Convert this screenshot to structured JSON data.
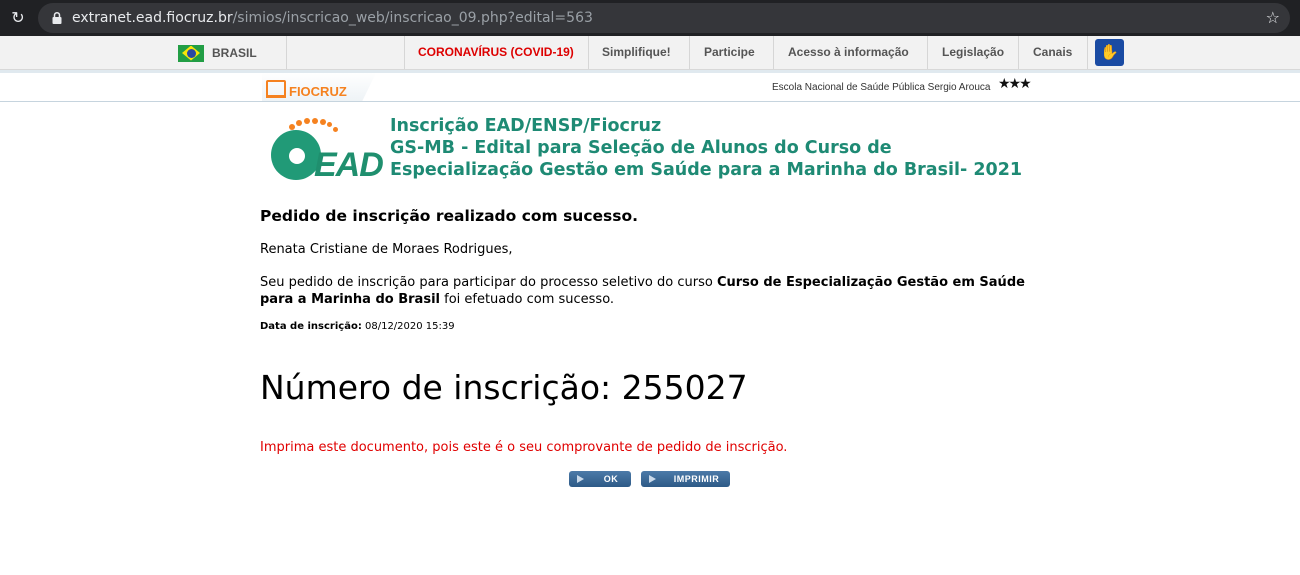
{
  "browser": {
    "url_host": "extranet.ead.fiocruz.br",
    "url_path": "/simios/inscricao_web/inscricao_09.php?edital=563",
    "reload_icon": "reload-icon",
    "lock_icon": "lock-icon",
    "star_icon": "star-icon"
  },
  "govbar": {
    "brasil": "BRASIL",
    "links": [
      "CORONAVÍRUS (COVID-19)",
      "Simplifique!",
      "Participe",
      "Acesso à informação",
      "Legislação",
      "Canais"
    ],
    "highlight_color": "#dd0000",
    "accessibility_icon": "accessibility-icon"
  },
  "fiocruz": {
    "logo_text": "FIOCRUZ",
    "ensp_text": "Escola Nacional de Saúde Pública Sergio Arouca",
    "brand_color": "#f58220"
  },
  "header": {
    "logo_text": "EAD",
    "title_line1": "Inscrição EAD/ENSP/Fiocruz",
    "title_line2": "GS-MB - Edital para Seleção de Alunos do Curso de",
    "title_line3": "Especialização Gestão em Saúde para a Marinha do Brasil- 2021",
    "title_color": "#1e8a74"
  },
  "content": {
    "success": "Pedido de inscrição realizado com sucesso.",
    "name": "Renata Cristiane de Moraes Rodrigues,",
    "msg_pre": "Seu pedido de inscrição para participar do processo seletivo do curso ",
    "msg_course": "Curso de Especialização Gestão em Saúde para a Marinha do Brasil",
    "msg_post": " foi efetuado com sucesso.",
    "date_label": "Data de inscrição:",
    "date_value": " 08/12/2020 15:39",
    "number": "Número de inscrição: 255027",
    "print_notice": "Imprima este documento, pois este é o seu comprovante de pedido de inscrição.",
    "notice_color": "#e00000"
  },
  "buttons": {
    "ok": "OK",
    "print": "IMPRIMIR",
    "color": "#2d5a87"
  }
}
